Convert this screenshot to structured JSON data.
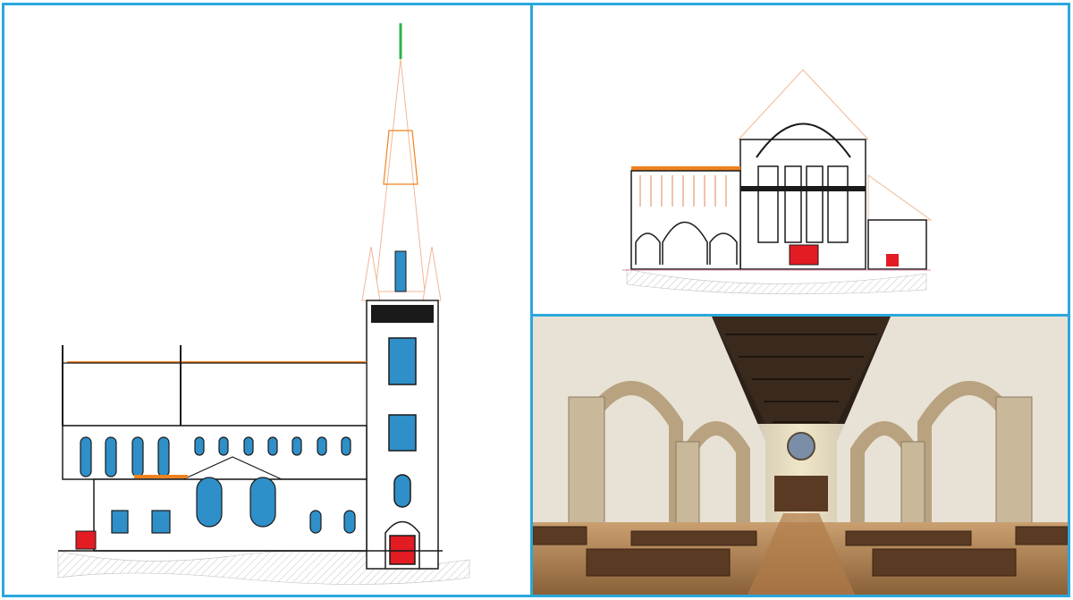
{
  "colors": {
    "frame_border": "#2aa7dc",
    "outline": "#1a1a1a",
    "window_blue": "#2f8fc8",
    "door_red": "#e31b23",
    "roof_orange": "#f0821e",
    "spire_tip_green": "#2fb34a",
    "hatch_grey": "#b5b5b5",
    "stone": "#c9b89a",
    "pew_wood": "#5a3a22",
    "ceiling_wood": "#2c2018"
  },
  "panels": [
    {
      "id": "elevation",
      "icon": "church-elevation-drawing-icon"
    },
    {
      "id": "section",
      "icon": "church-section-drawing-icon"
    },
    {
      "id": "interior",
      "icon": "church-interior-photo-icon"
    }
  ]
}
